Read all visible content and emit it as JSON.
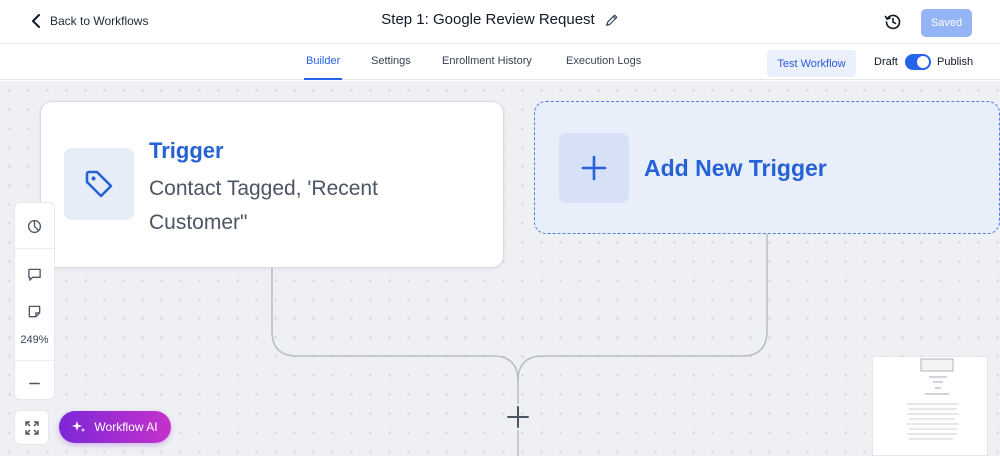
{
  "header": {
    "back_label": "Back to Workflows",
    "title": "Step 1: Google Review Request",
    "saved_label": "Saved"
  },
  "tabs": [
    {
      "label": "Builder",
      "active": true
    },
    {
      "label": "Settings",
      "active": false
    },
    {
      "label": "Enrollment History",
      "active": false
    },
    {
      "label": "Execution Logs",
      "active": false
    }
  ],
  "actions": {
    "test_label": "Test Workflow",
    "draft_label": "Draft",
    "publish_label": "Publish",
    "publish_enabled": true
  },
  "canvas": {
    "trigger": {
      "title": "Trigger",
      "description": "Contact Tagged, 'Recent Customer\""
    },
    "add_trigger": {
      "title": "Add New Trigger"
    }
  },
  "toolbar": {
    "zoom": "249%"
  },
  "ai": {
    "label": "Workflow AI"
  },
  "colors": {
    "accent": "#2563eb",
    "saved_button": "#93b4f5",
    "ai_gradient_start": "#7c28d8",
    "ai_gradient_end": "#c531c9",
    "canvas_bg": "#eff0f3"
  },
  "icons": {
    "back": "chevron-left-icon",
    "edit": "pencil-icon",
    "history": "history-icon",
    "trigger": "tag-icon",
    "add": "plus-icon",
    "timer": "pie-chart-icon",
    "comment": "comment-icon",
    "note": "sticky-note-icon",
    "zoom_out": "minus-icon",
    "fullscreen": "expand-icon",
    "ai": "sparkle-icon"
  }
}
